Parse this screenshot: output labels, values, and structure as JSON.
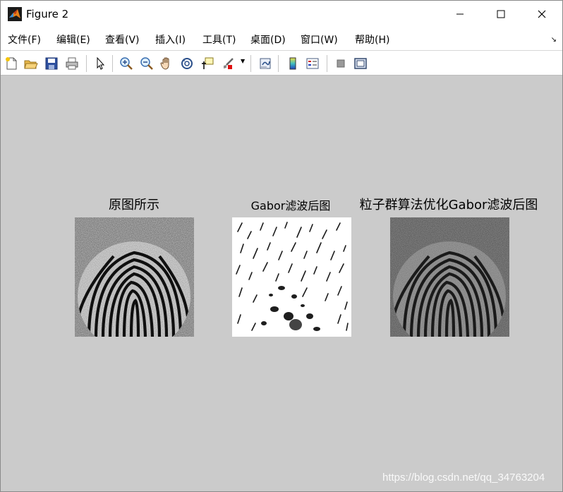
{
  "window": {
    "title": "Figure 2"
  },
  "menu": {
    "items": [
      {
        "label": "文件(F)"
      },
      {
        "label": "编辑(E)"
      },
      {
        "label": "查看(V)"
      },
      {
        "label": "插入(I)"
      },
      {
        "label": "工具(T)"
      },
      {
        "label": "桌面(D)"
      },
      {
        "label": "窗口(W)"
      },
      {
        "label": "帮助(H)"
      }
    ],
    "overflow_arrow": "↘"
  },
  "toolbar": {
    "buttons": [
      {
        "icon": "new-figure-icon"
      },
      {
        "icon": "open-file-icon"
      },
      {
        "icon": "save-icon"
      },
      {
        "icon": "print-icon"
      },
      {
        "icon": "edit-plot-pointer-icon"
      },
      {
        "icon": "zoom-in-icon"
      },
      {
        "icon": "zoom-out-icon"
      },
      {
        "icon": "pan-hand-icon"
      },
      {
        "icon": "rotate-3d-icon"
      },
      {
        "icon": "data-cursor-icon"
      },
      {
        "icon": "brush-icon"
      },
      {
        "icon": "link-plot-icon"
      },
      {
        "icon": "colorbar-icon"
      },
      {
        "icon": "legend-icon"
      },
      {
        "icon": "hide-plot-tools-icon"
      },
      {
        "icon": "show-plot-tools-icon"
      }
    ]
  },
  "figure": {
    "background": "#cbcbcb",
    "panels": [
      {
        "title": "原图所示",
        "image": "noisy fingerprint"
      },
      {
        "title": "Gabor滤波后图",
        "image": "gabor filtered fingerprint"
      },
      {
        "title": "粒子群算法优化Gabor滤波后图",
        "image": "pso optimized gabor fingerprint"
      }
    ]
  },
  "watermark": "https://blog.csdn.net/qq_34763204"
}
